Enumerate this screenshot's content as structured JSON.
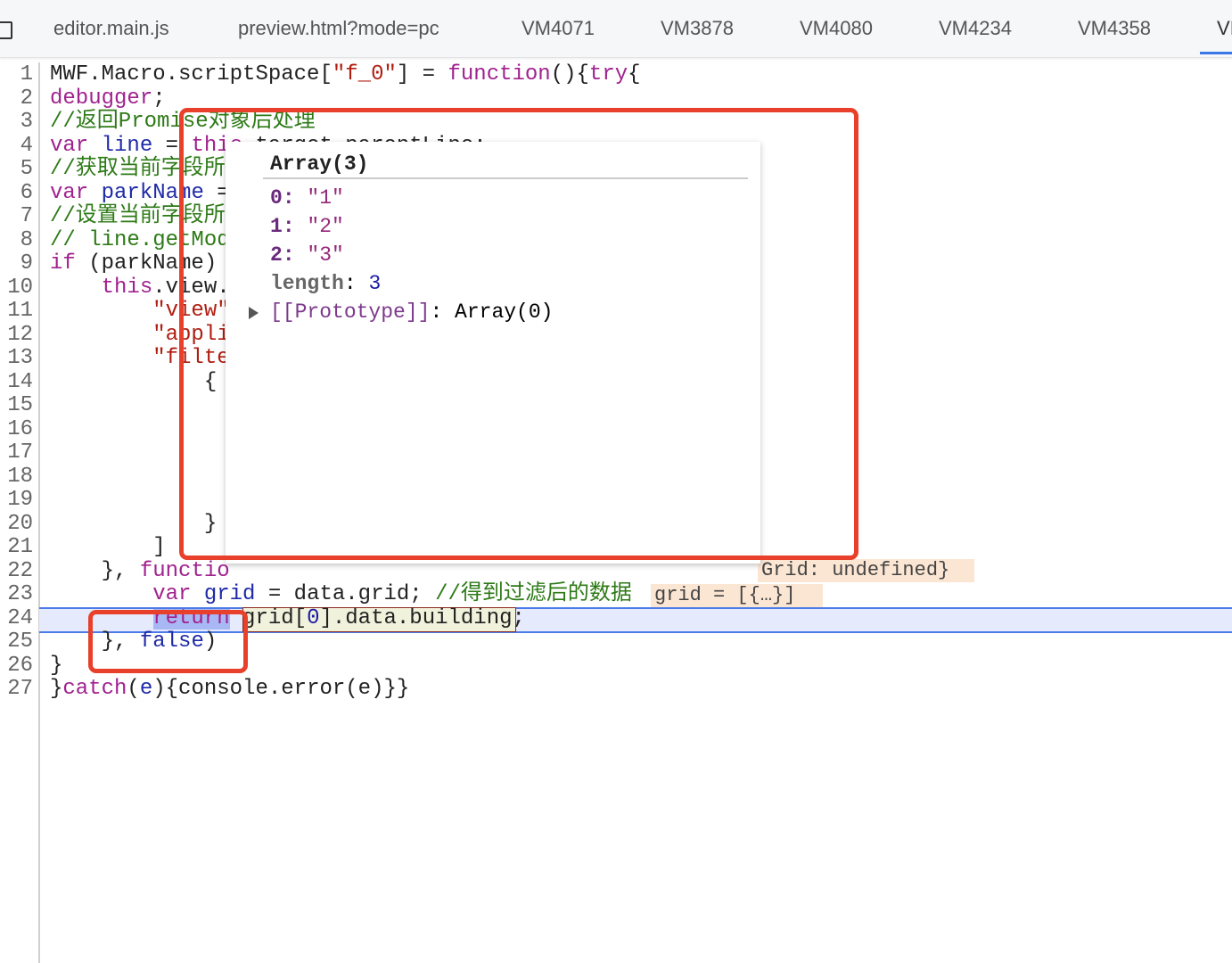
{
  "tabs": [
    "editor.main.js",
    "preview.html?mode=pc",
    "VM4071",
    "VM3878",
    "VM4080",
    "VM4234",
    "VM4358",
    "VI"
  ],
  "active_tab": "VI",
  "line_numbers": [
    "1",
    "2",
    "3",
    "4",
    "5",
    "6",
    "7",
    "8",
    "9",
    "10",
    "11",
    "12",
    "13",
    "14",
    "15",
    "16",
    "17",
    "18",
    "19",
    "20",
    "21",
    "22",
    "23",
    "24",
    "25",
    "26",
    "27"
  ],
  "code": [
    [
      [
        "MWF.Macro.scriptSpace[",
        ""
      ],
      [
        "\"f_0\"",
        "str"
      ],
      [
        "] = ",
        ""
      ],
      [
        "function",
        "kw"
      ],
      [
        "(){",
        ""
      ],
      [
        "try",
        "kw"
      ],
      [
        "{",
        ""
      ]
    ],
    [
      [
        "debugger",
        "kw"
      ],
      [
        ";",
        ""
      ]
    ],
    [
      [
        "//返回Promise对象后处理",
        "cm"
      ]
    ],
    [
      [
        "var",
        "kw"
      ],
      [
        " ",
        ""
      ],
      [
        "line",
        "var"
      ],
      [
        " = ",
        ""
      ],
      [
        "this",
        "kw"
      ],
      [
        ".target.parentLine;",
        ""
      ]
    ],
    [
      [
        "//获取当前字段所",
        "cm"
      ]
    ],
    [
      [
        "var",
        "kw"
      ],
      [
        " ",
        ""
      ],
      [
        "parkName",
        "var"
      ],
      [
        " =",
        ""
      ]
    ],
    [
      [
        "//设置当前字段所",
        "cm"
      ]
    ],
    [
      [
        "// line.getMod",
        "cm"
      ]
    ],
    [
      [
        "if",
        "kw"
      ],
      [
        " (parkName)",
        ""
      ]
    ],
    [
      [
        "    ",
        ""
      ],
      [
        "this",
        "kw"
      ],
      [
        ".view.",
        ""
      ]
    ],
    [
      [
        "        ",
        ""
      ],
      [
        "\"view\"",
        "str"
      ]
    ],
    [
      [
        "        ",
        ""
      ],
      [
        "\"appli",
        "str"
      ]
    ],
    [
      [
        "        ",
        ""
      ],
      [
        "\"filte",
        "str"
      ]
    ],
    [
      [
        "            {",
        ""
      ]
    ],
    [],
    [],
    [],
    [],
    [],
    [
      [
        "            }",
        ""
      ]
    ],
    [
      [
        "        ]",
        ""
      ]
    ],
    [
      [
        "    }, ",
        ""
      ],
      [
        "functio",
        "kw"
      ]
    ],
    [
      [
        "        ",
        ""
      ],
      [
        "var",
        "kw"
      ],
      [
        " ",
        ""
      ],
      [
        "grid",
        "var"
      ],
      [
        " = data.grid; ",
        ""
      ],
      [
        "//得到过滤后的数据",
        "cm"
      ]
    ],
    [
      [
        "        ",
        ""
      ],
      [
        "return",
        "kw"
      ],
      [
        " grid[",
        ""
      ],
      [
        "0",
        "num"
      ],
      [
        "].data.building;",
        ""
      ]
    ],
    [
      [
        "    }, ",
        ""
      ],
      [
        "false",
        "var"
      ],
      [
        ")",
        ""
      ]
    ],
    [
      [
        "}",
        ""
      ]
    ],
    [
      [
        "}",
        ""
      ],
      [
        "catch",
        "kw"
      ],
      [
        "(",
        ""
      ],
      [
        "e",
        "var"
      ],
      [
        "){console.error(e)}}",
        ""
      ]
    ]
  ],
  "inline_values": {
    "line22": "Grid: undefined}",
    "line23": "grid = [{…}]"
  },
  "popup": {
    "title": "Array(3)",
    "items": [
      {
        "key": "0",
        "value": "\"1\""
      },
      {
        "key": "1",
        "value": "\"2\""
      },
      {
        "key": "2",
        "value": "\"3\""
      }
    ],
    "length_label": "length",
    "length_value": "3",
    "prototype_label": "[[Prototype]]",
    "prototype_value": "Array(0)"
  }
}
